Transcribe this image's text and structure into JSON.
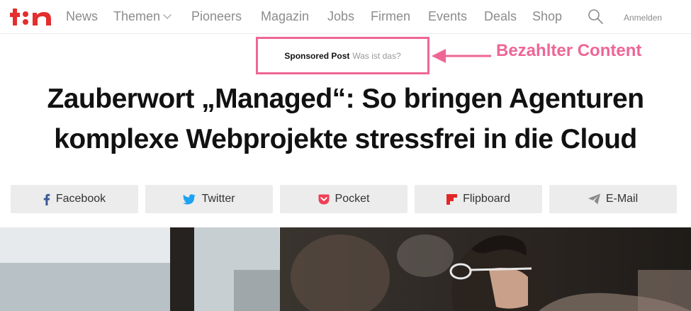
{
  "nav": {
    "logo_text": "t3n",
    "items": [
      {
        "label": "News"
      },
      {
        "label": "Themen"
      },
      {
        "label": "Pioneers"
      },
      {
        "label": "Magazin"
      },
      {
        "label": "Jobs"
      },
      {
        "label": "Firmen"
      },
      {
        "label": "Events"
      },
      {
        "label": "Deals"
      },
      {
        "label": "Shop"
      }
    ],
    "search_icon": "search-icon",
    "login_label": "Anmelden"
  },
  "sponsor": {
    "label": "Sponsored Post",
    "link": "Was ist das?",
    "annotation": "Bezahlter Content",
    "highlight_color": "#ee6696"
  },
  "article": {
    "title_line1": "Zauberwort „Managed“: So bringen Agenturen",
    "title_line2": "komplexe Webprojekte stressfrei in die Cloud"
  },
  "share": [
    {
      "label": "Facebook",
      "icon": "facebook-icon",
      "color": "#3b5998"
    },
    {
      "label": "Twitter",
      "icon": "twitter-icon",
      "color": "#1da1f2"
    },
    {
      "label": "Pocket",
      "icon": "pocket-icon",
      "color": "#ef4056"
    },
    {
      "label": "Flipboard",
      "icon": "flipboard-icon",
      "color": "#e12828"
    },
    {
      "label": "E-Mail",
      "icon": "paper-plane-icon",
      "color": "#8a8a8a"
    }
  ],
  "colors": {
    "brand": "#e42d2d",
    "nav_text": "#8c8c8c",
    "button_bg": "#ececec"
  }
}
